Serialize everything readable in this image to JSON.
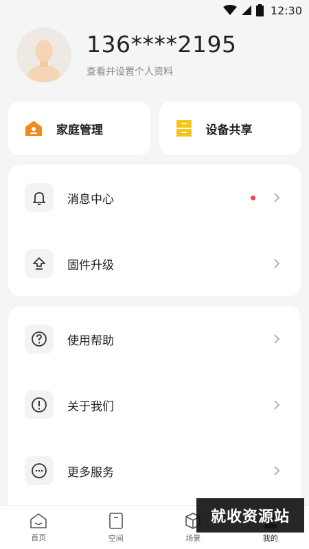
{
  "status_bar": {
    "time": "12:30"
  },
  "profile": {
    "phone": "136****2195",
    "subtitle": "查看并设置个人资料"
  },
  "quick_actions": [
    {
      "label": "家庭管理",
      "icon": "home-icon"
    },
    {
      "label": "设备共享",
      "icon": "drawer-share-icon"
    }
  ],
  "menu_group_1": [
    {
      "label": "消息中心",
      "icon": "bell-icon",
      "badge_dot": true
    },
    {
      "label": "固件升级",
      "icon": "upgrade-icon",
      "badge_dot": false
    }
  ],
  "menu_group_2": [
    {
      "label": "使用帮助",
      "icon": "help-icon"
    },
    {
      "label": "关于我们",
      "icon": "info-icon"
    },
    {
      "label": "更多服务",
      "icon": "more-icon"
    }
  ],
  "tab_bar": [
    {
      "label": "首页",
      "icon": "home-tab-icon"
    },
    {
      "label": "空间",
      "icon": "space-tab-icon"
    },
    {
      "label": "场景",
      "icon": "scene-tab-icon"
    },
    {
      "label": "我的",
      "icon": "mine-tab-icon",
      "active": true
    }
  ],
  "watermark": {
    "text": "就收资源站"
  },
  "colors": {
    "accent_orange": "#f5891f",
    "accent_yellow": "#f5c518",
    "badge_red": "#ef4444"
  }
}
